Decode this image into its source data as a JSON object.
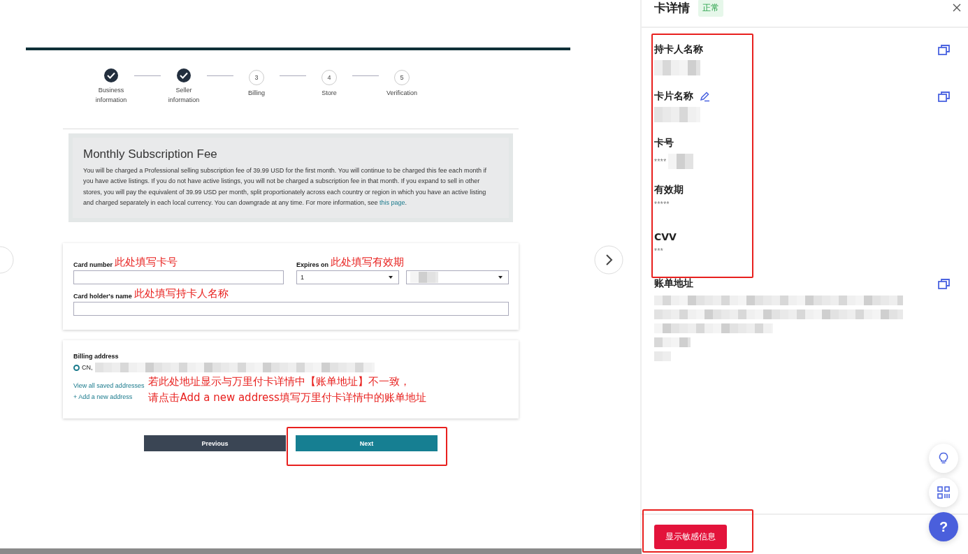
{
  "stepper": {
    "steps": [
      {
        "label": "Business information",
        "done": true
      },
      {
        "label": "Seller information",
        "done": true
      },
      {
        "label": "Billing",
        "number": "3",
        "done": false
      },
      {
        "label": "Store",
        "number": "4",
        "done": false
      },
      {
        "label": "Verification",
        "number": "5",
        "done": false
      }
    ]
  },
  "fee_notice": {
    "title": "Monthly Subscription Fee",
    "body": "You will be charged a Professional selling subscription fee of 39.99 USD for the first month. You will continue to be charged this fee each month if you have active listings. If you do not have active listings, you will not be charged a subscription fee in that month. If you expand to sell in other stores, you will pay the equivalent of 39.99 USD per month, split proportionately across each country or region in which you have an active listing and charged separately in each local currency. You can downgrade at any time. For more information, see",
    "link": "this page",
    "end": "."
  },
  "card_form": {
    "card_number": {
      "label": "Card number",
      "annotation": "此处填写卡号"
    },
    "expires_on": {
      "label": "Expires on",
      "annotation": "此处填写有效期",
      "month": "1",
      "year_redacted": true
    },
    "holder_name": {
      "label": "Card holder's name",
      "annotation": "此处填写持卡人名称"
    }
  },
  "billing": {
    "label": "Billing address",
    "addresses": [
      {
        "prefix": "CN,",
        "selected": true,
        "redacted": true
      }
    ],
    "links": [
      "View all saved addresses",
      "+ Add a new address"
    ],
    "annotation": [
      "若此处地址显示与万里付卡详情中【账单地址】不一致，",
      "请点击Add a new address填写万里付卡详情中的账单地址"
    ]
  },
  "buttons": [
    {
      "label": "Previous",
      "kind": "secondary",
      "highlighted": false
    },
    {
      "label": "Next",
      "kind": "primary",
      "highlighted": true
    }
  ],
  "card_details": {
    "title": "卡详情",
    "status": "正常",
    "fields": [
      {
        "label": "持卡人名称",
        "editable": false,
        "copyable": true,
        "redacted": true
      },
      {
        "label": "卡片名称",
        "editable": true,
        "copyable": true,
        "redacted": true
      },
      {
        "label": "卡号",
        "value": "****",
        "editable": false,
        "copyable": false,
        "redacted": true
      },
      {
        "label": "有效期",
        "value": "*****",
        "editable": false,
        "copyable": false,
        "redacted": false
      },
      {
        "label": "CVV",
        "value": "***",
        "editable": false,
        "copyable": false,
        "redacted": false
      },
      {
        "label": "账单地址",
        "editable": false,
        "copyable": true,
        "redacted": true,
        "kind": "address"
      }
    ],
    "fields_highlighted": true,
    "reveal_button": {
      "label": "显示敏感信息",
      "highlighted": true
    }
  },
  "floating_buttons": [
    {
      "kind": "bulb"
    },
    {
      "kind": "qr"
    },
    {
      "kind": "help",
      "label": "?"
    }
  ]
}
